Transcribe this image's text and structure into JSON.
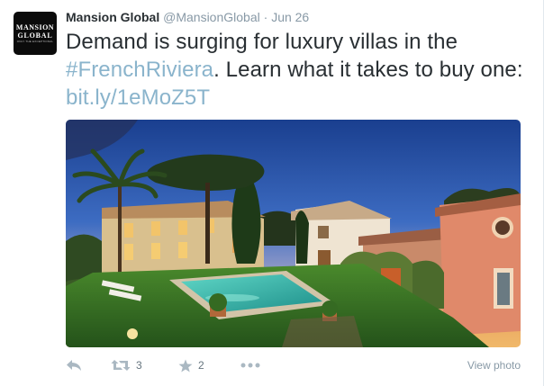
{
  "tweet": {
    "avatar_line1": "MANSION",
    "avatar_line2": "GLOBAL",
    "avatar_line3": "ONLY THE EXCEPTIONAL",
    "fullname": "Mansion Global",
    "username": "@MansionGlobal",
    "separator": "·",
    "time": "Jun 26",
    "text_part1": "Demand is surging for luxury villas in the ",
    "hashtag": "#FrenchRiviera",
    "text_part2": ". Learn what it takes to buy one: ",
    "link": "bit.ly/1eMoZ5T"
  },
  "actions": {
    "reply_icon": "reply-icon",
    "retweet_icon": "retweet-icon",
    "retweet_count": "3",
    "favorite_icon": "star-icon",
    "favorite_count": "2",
    "more_icon": "more-icon",
    "view_photo": "View photo"
  },
  "colors": {
    "link": "#8ab4cc",
    "text": "#292f33",
    "muted": "#8899a6",
    "icon": "#aab8c2"
  }
}
